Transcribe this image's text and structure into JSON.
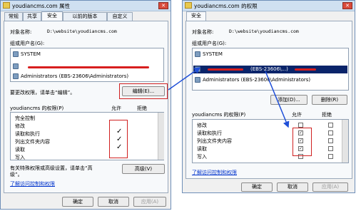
{
  "left": {
    "title": "youdiancms.com 属性",
    "tabs": [
      "常规",
      "共享",
      "安全",
      "以前的版本",
      "自定义"
    ],
    "object_label": "对象名称:",
    "object_value": "D:\\website\\youdiancms.com",
    "group_label": "组或用户名(G):",
    "users": [
      "SYSTEM",
      "Administrators (EBS-23606\\Administrators)"
    ],
    "change_hint": "要更改权限，请单击“编辑”。",
    "edit_button": "编辑(E)...",
    "perm_header": "youdiancms 的权限(P)",
    "allow_header": "允许",
    "deny_header": "拒绝",
    "permissions": [
      "完全控制",
      "修改",
      "读取和执行",
      "列出文件夹内容",
      "读取",
      "写入"
    ],
    "checks": [
      "✓",
      "✓",
      "✓"
    ],
    "special_hint_1": "有关特殊权限或高级设置，请单击“高",
    "special_hint_2": "级”。",
    "advanced_button": "高级(V)",
    "learn_link": "了解访问控制和权限",
    "ok": "确定",
    "cancel": "取消",
    "apply": "应用(A)"
  },
  "right": {
    "title": "youdiancms.com 的权限",
    "tab": "安全",
    "object_label": "对象名称:",
    "object_value": "D:\\website\\youdiancms.com",
    "group_label": "组或用户名(G):",
    "users": [
      "SYSTEM",
      "Administrators (EBS-23606\\Administrators)"
    ],
    "selected_user_tail": "(EBS-23606\\...)",
    "add_button": "添加(D)...",
    "remove_button": "删除(R)",
    "perm_header": "youdiancms 的权限(P)",
    "allow_header": "允许",
    "deny_header": "拒绝",
    "permissions": [
      "修改",
      "读取和执行",
      "列出文件夹内容",
      "读取",
      "写入"
    ],
    "learn_link": "了解访问控制和权限",
    "ok": "确定",
    "cancel": "取消",
    "apply": "应用(A)"
  },
  "colors": {
    "accent": "#0a246a",
    "annotation_red": "#d02020",
    "arrow_blue": "#1f4fd8"
  }
}
